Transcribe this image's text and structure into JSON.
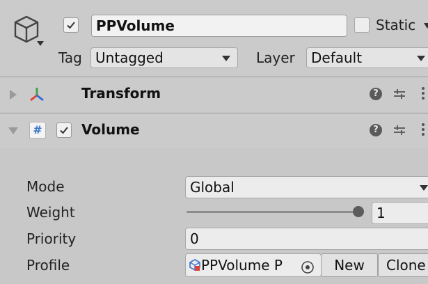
{
  "header": {
    "name": "PPVolume",
    "active_checked": true,
    "static_label": "Static",
    "static_checked": false,
    "tag_label": "Tag",
    "tag_value": "Untagged",
    "layer_label": "Layer",
    "layer_value": "Default"
  },
  "components": [
    {
      "title": "Transform",
      "expanded": false
    },
    {
      "title": "Volume",
      "expanded": true,
      "enabled": true
    }
  ],
  "volume": {
    "mode_label": "Mode",
    "mode_value": "Global",
    "weight_label": "Weight",
    "weight_value": "1",
    "weight_slider_fraction": 1.0,
    "priority_label": "Priority",
    "priority_value": "0",
    "profile_label": "Profile",
    "profile_value": "PPVolume P",
    "new_button": "New",
    "clone_button": "Clone"
  },
  "icons": {
    "gameobject": "cube-icon",
    "transform": "transform-axes-icon",
    "volume_script": "script-hash-icon",
    "help": "help-icon",
    "presets": "presets-sliders-icon",
    "menu": "kebab-menu-icon",
    "object_picker": "object-picker-icon",
    "profile_asset": "profile-asset-icon"
  },
  "colors": {
    "panel_bg": "#c8c8c8",
    "field_bg": "#ececec",
    "transform_red": "#e0423a",
    "transform_green": "#3fa34d",
    "transform_blue": "#2f6fd6",
    "script_blue": "#3a73c9"
  }
}
